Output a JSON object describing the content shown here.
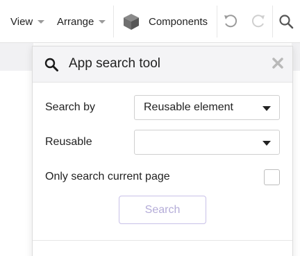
{
  "toolbar": {
    "view_label": "View",
    "arrange_label": "Arrange",
    "components_label": "Components",
    "icons": [
      "undo-icon",
      "redo-icon",
      "search-icon"
    ]
  },
  "panel": {
    "title": "App search tool",
    "search_by_label": "Search by",
    "search_by_value": "Reusable element",
    "reusable_label": "Reusable",
    "reusable_value": "",
    "only_current_page_label": "Only search current page",
    "only_current_page_checked": false,
    "search_button_label": "Search"
  },
  "colors": {
    "search_button_border": "#c8c0e8",
    "search_button_text": "#b4acd8",
    "header_background": "#f4f4f6"
  }
}
